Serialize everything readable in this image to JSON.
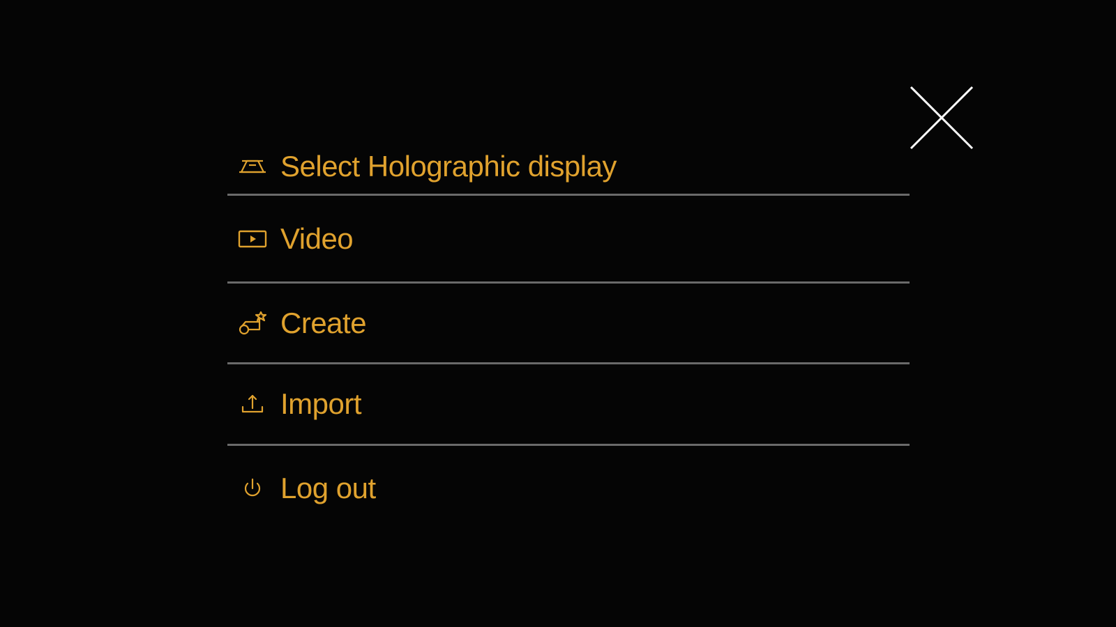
{
  "menu": {
    "items": [
      {
        "label": "Select Holographic display",
        "icon": "holographic-display-icon"
      },
      {
        "label": "Video",
        "icon": "video-icon"
      },
      {
        "label": "Create",
        "icon": "create-icon"
      },
      {
        "label": "Import",
        "icon": "import-icon"
      },
      {
        "label": "Log out",
        "icon": "power-icon"
      }
    ]
  },
  "close": {
    "icon": "close-icon"
  },
  "colors": {
    "accent": "#e0a22e",
    "background": "#050505",
    "divider": "#6a6a6a",
    "close": "#ffffff"
  }
}
